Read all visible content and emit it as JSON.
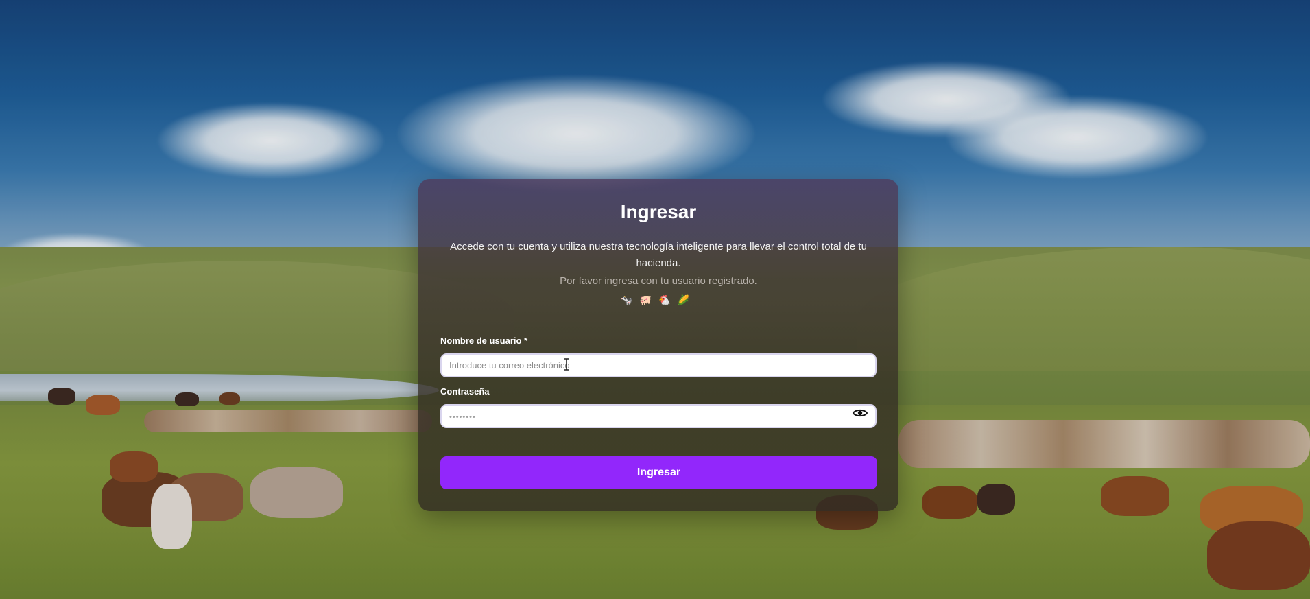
{
  "login": {
    "title": "Ingresar",
    "description": "Accede con tu cuenta y utiliza nuestra tecnología inteligente para llevar el control total de tu hacienda.",
    "hint": "Por favor ingresa con tu usuario registrado.",
    "icons": [
      "cow-icon",
      "pig-icon",
      "chicken-icon",
      "corn-icon"
    ],
    "username": {
      "label": "Nombre de usuario *",
      "placeholder": "Introduce tu correo electrónico",
      "value": ""
    },
    "password": {
      "label": "Contraseña",
      "placeholder": "••••••••",
      "value": ""
    },
    "submit_label": "Ingresar"
  },
  "colors": {
    "accent": "#9227fb",
    "card_background": "#3a342c",
    "title": "#ffffff"
  }
}
